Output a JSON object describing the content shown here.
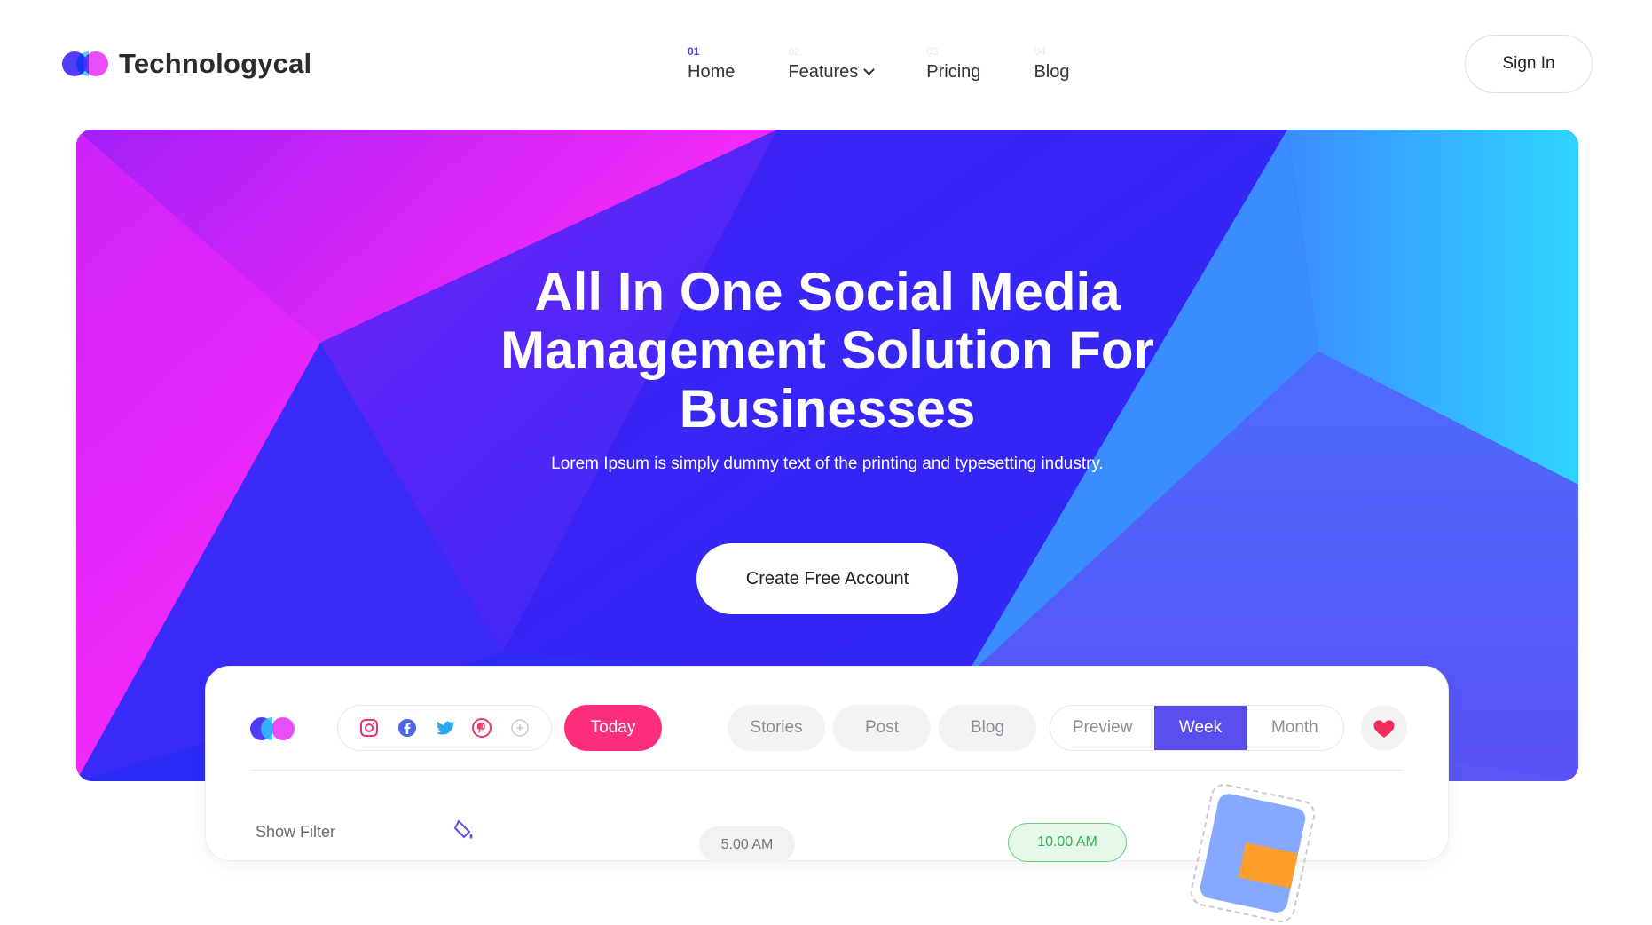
{
  "brand": {
    "name": "Technologycal"
  },
  "nav": {
    "items": [
      {
        "num": "01",
        "label": "Home",
        "active": true
      },
      {
        "num": "02",
        "label": "Features",
        "dropdown": true
      },
      {
        "num": "03",
        "label": "Pricing"
      },
      {
        "num": "04",
        "label": "Blog"
      }
    ],
    "signin_label": "Sign In"
  },
  "hero": {
    "title_lines": [
      "All In One Social Media",
      "Management Solution For",
      "Businesses"
    ],
    "subtitle": "Lorem Ipsum is simply dummy text of the printing and typesetting industry.",
    "cta_label": "Create Free Account"
  },
  "dashboard": {
    "social_icons": [
      "instagram-icon",
      "facebook-icon",
      "twitter-icon",
      "pinterest-icon",
      "add-icon"
    ],
    "today_label": "Today",
    "content_tabs": [
      "Stories",
      "Post",
      "Blog"
    ],
    "view_modes": {
      "preview": "Preview",
      "week": "Week",
      "month": "Month",
      "selected": "Week"
    },
    "show_filter_label": "Show Filter",
    "time_slots": [
      "5.00 AM",
      "10.00 AM"
    ]
  },
  "colors": {
    "accent": "#5b4ef0",
    "today": "#fd2e7c",
    "hero_purple": "#3b22f5",
    "hero_pink": "#f42af9",
    "hero_cyan": "#2fd0ff"
  }
}
